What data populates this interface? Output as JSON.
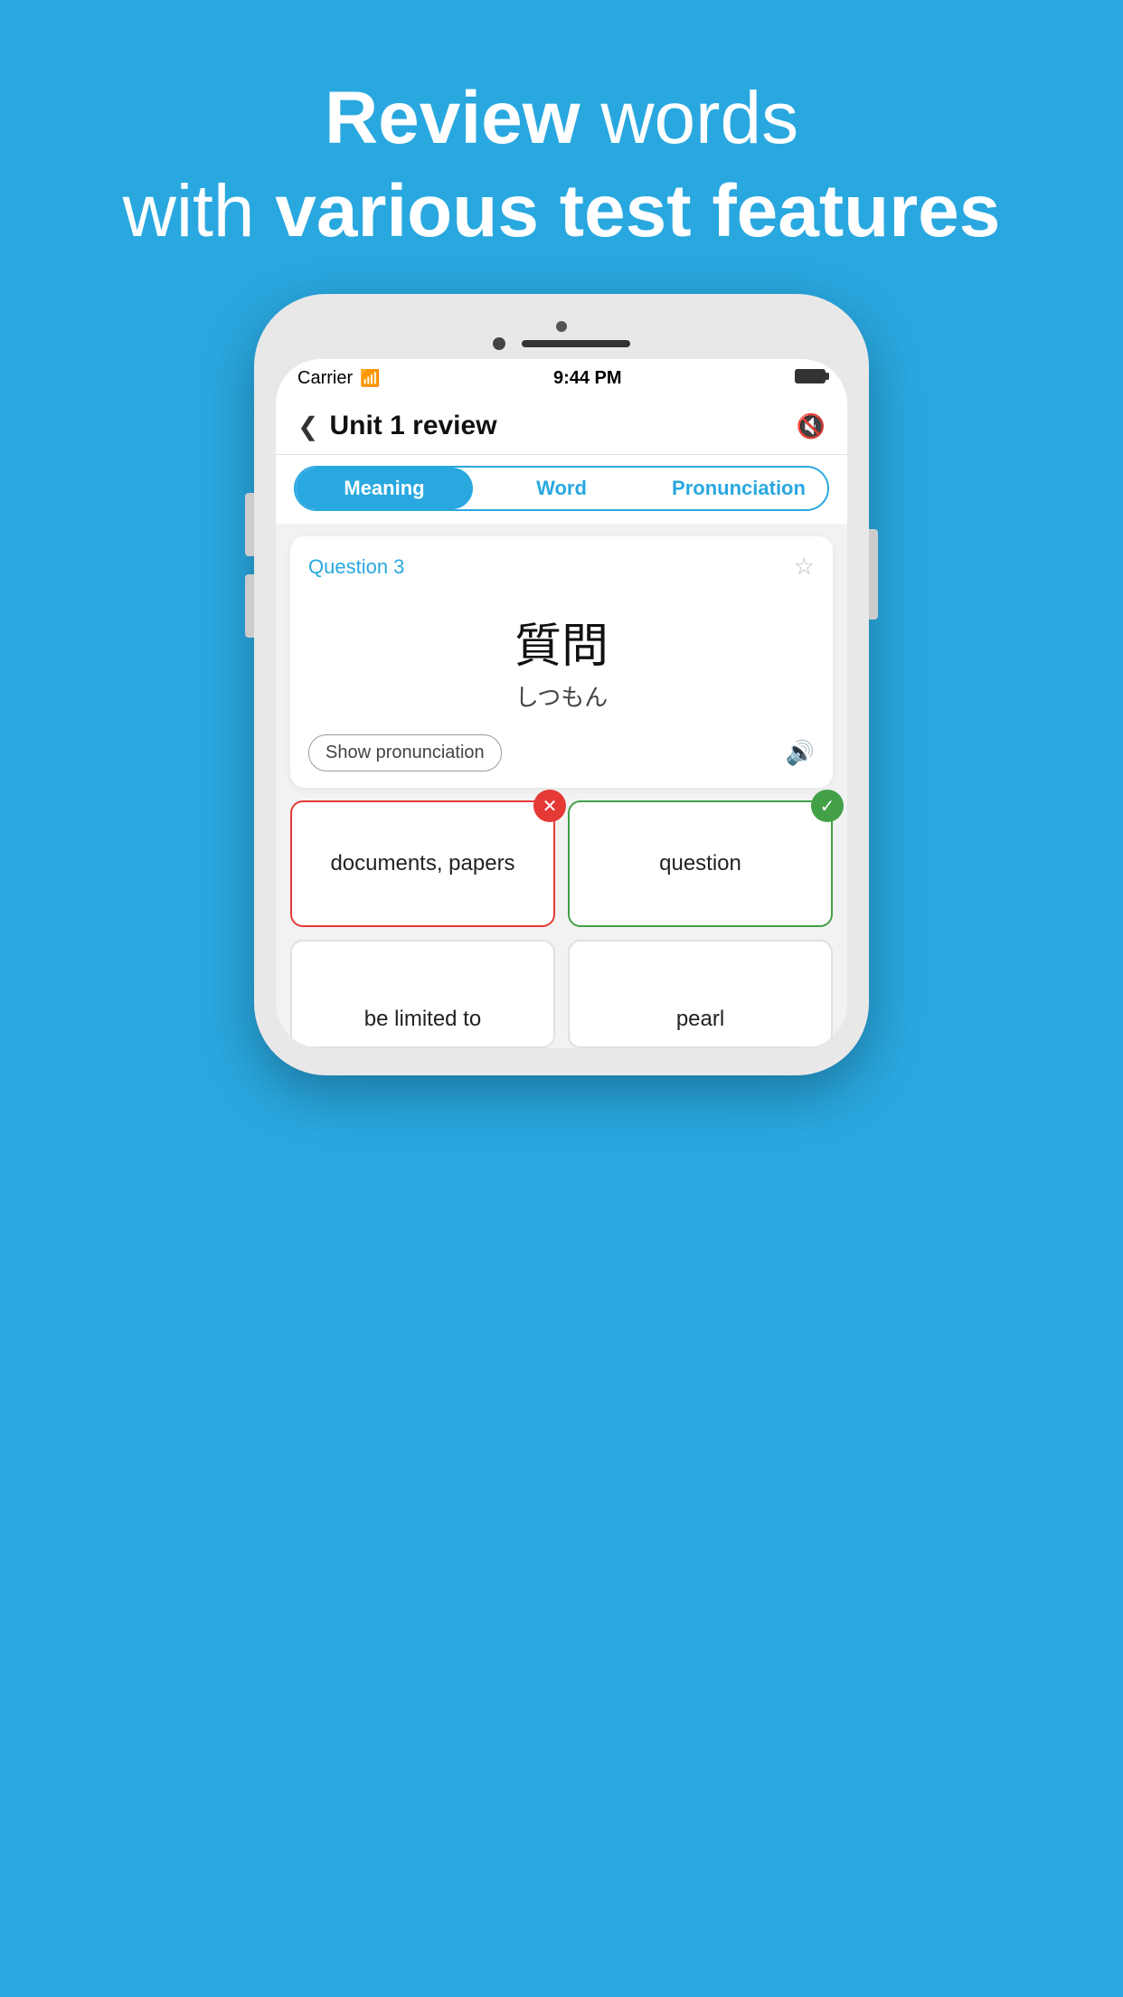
{
  "background_color": "#29A8E0",
  "header": {
    "line1_normal": " words",
    "line1_bold": "Review",
    "line2_prefix": "with ",
    "line2_bold": "various test features"
  },
  "status_bar": {
    "carrier": "Carrier",
    "time": "9:44 PM"
  },
  "nav": {
    "title": "Unit 1 review",
    "back_label": "‹"
  },
  "tabs": [
    {
      "label": "Meaning",
      "active": true
    },
    {
      "label": "Word",
      "active": false
    },
    {
      "label": "Pronunciation",
      "active": false
    }
  ],
  "question": {
    "label": "Question  3",
    "kanji": "質問",
    "reading": "しつもん",
    "show_pronunciation_btn": "Show pronunciation"
  },
  "answers": [
    {
      "text": "documents, papers",
      "state": "wrong"
    },
    {
      "text": "question",
      "state": "correct"
    }
  ],
  "bottom_answers": [
    {
      "text": "be limited to"
    },
    {
      "text": "pearl"
    }
  ],
  "icons": {
    "back": "❮",
    "mute": "🔇",
    "star": "☆",
    "speaker": "🔊",
    "wrong": "✕",
    "correct": "✓"
  }
}
